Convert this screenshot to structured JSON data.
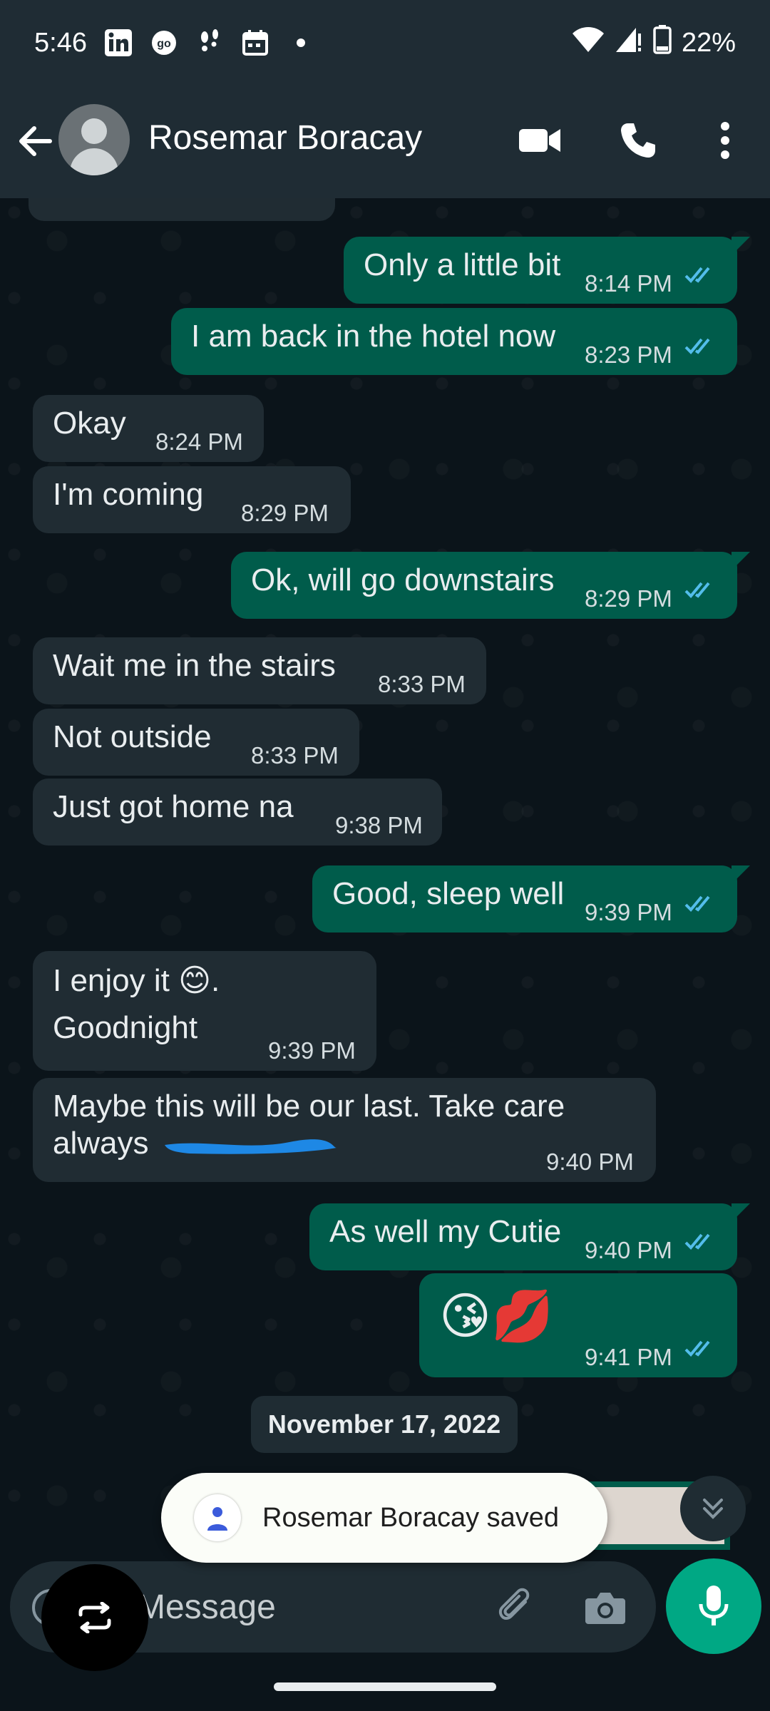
{
  "status_bar": {
    "time": "5:46",
    "battery": "22%",
    "icons": [
      "linkedin-icon",
      "go-icon",
      "footprints-icon",
      "calendar-icon",
      "dot-icon",
      "wifi-icon",
      "signal-icon",
      "battery-icon"
    ]
  },
  "header": {
    "contact_name": "Rosemar Boracay",
    "icons": [
      "back-arrow-icon",
      "avatar",
      "video-call-icon",
      "voice-call-icon",
      "more-vert-icon"
    ]
  },
  "messages": [
    {
      "dir": "out",
      "text": "Only a little bit",
      "time": "8:14 PM",
      "read": true
    },
    {
      "dir": "out",
      "text": "I am back in the hotel now",
      "time": "8:23 PM",
      "read": true
    },
    {
      "dir": "in",
      "text": "Okay",
      "time": "8:24 PM"
    },
    {
      "dir": "in",
      "text": "I'm coming",
      "time": "8:29 PM"
    },
    {
      "dir": "out",
      "text": "Ok, will go downstairs",
      "time": "8:29 PM",
      "read": true
    },
    {
      "dir": "in",
      "text": "Wait me in the stairs",
      "time": "8:33 PM"
    },
    {
      "dir": "in",
      "text": "Not outside",
      "time": "8:33 PM"
    },
    {
      "dir": "in",
      "text": "Just got home na",
      "time": "9:38 PM"
    },
    {
      "dir": "out",
      "text": "Good, sleep well",
      "time": "9:39 PM",
      "read": true
    },
    {
      "dir": "in",
      "text_line1": "I enjoy it 😊.",
      "text_line2": "Goodnight",
      "time": "9:39 PM"
    },
    {
      "dir": "in",
      "text_line1": "Maybe this will be our last. Take care",
      "text_line2": "always",
      "time": "9:40 PM"
    },
    {
      "dir": "out",
      "text": "As well my Cutie",
      "time": "9:40 PM",
      "read": true
    },
    {
      "dir": "out",
      "text": "😘💋",
      "time": "9:41 PM",
      "read": true
    }
  ],
  "date_separator": "November 17, 2022",
  "toast": {
    "text": "Rosemar Boracay saved"
  },
  "composer": {
    "placeholder": "Message"
  },
  "colors": {
    "header_bg": "#1f2c34",
    "chat_bg": "#0b141a",
    "incoming_bubble": "#202c33",
    "outgoing_bubble": "#005c4b",
    "read_ticks": "#53bdeb",
    "mic_button": "#00a884"
  }
}
